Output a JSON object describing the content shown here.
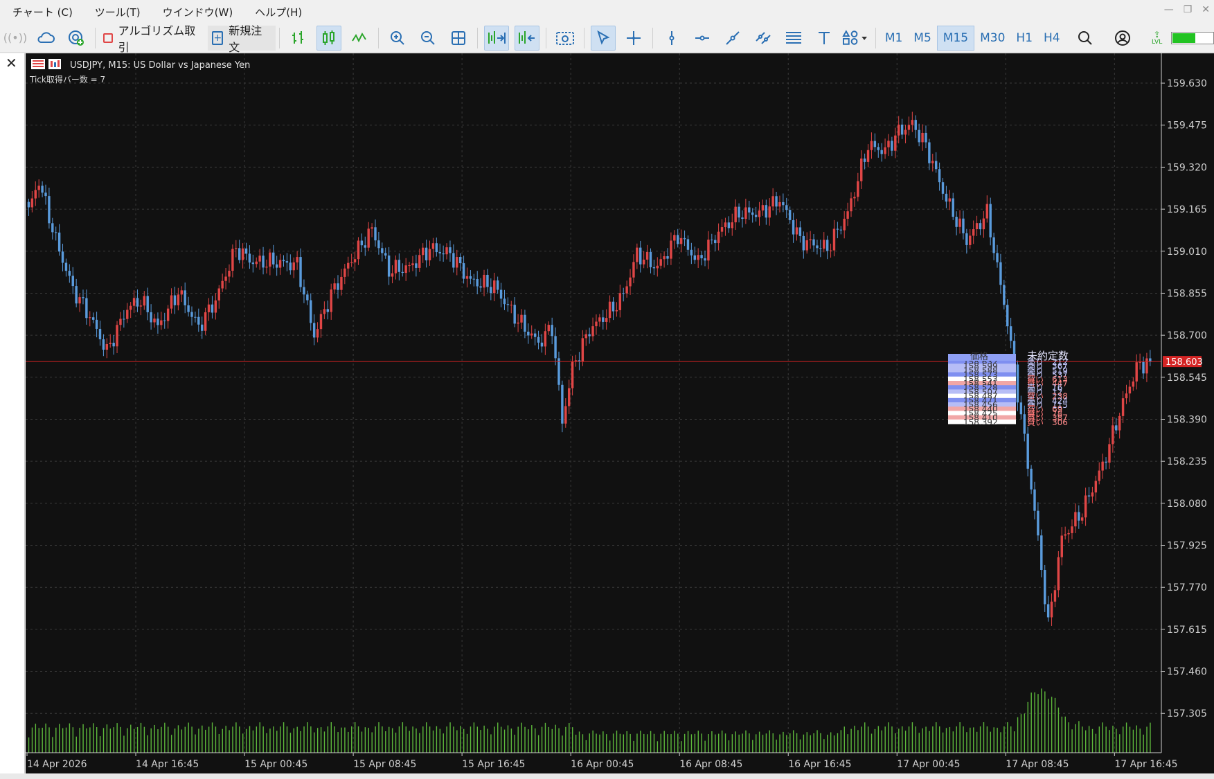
{
  "menu": [
    "チャート (C)",
    "ツール(T)",
    "ウインドウ(W)",
    "ヘルプ(H)"
  ],
  "window_controls": [
    "—",
    "❐",
    "✕"
  ],
  "toolbar": {
    "algo_label": "アルゴリズム取引",
    "new_order_label": "新規注文",
    "timeframes": [
      "M1",
      "M5",
      "M15",
      "M30",
      "H1",
      "H4"
    ],
    "active_timeframe": "M15",
    "level_label": "LVL",
    "level_fill_fraction": 0.55
  },
  "chart": {
    "title": "USDJPY, M15:  US Dollar vs Japanese Yen",
    "indicator_text": "Tick取得バー数 = 7",
    "current_price_label": "158.603",
    "order_book_headers": [
      "価格",
      "未約定数"
    ]
  },
  "colors": {
    "background": "#111111",
    "grid": "#3a3a3a",
    "bull": "#e04646",
    "bear": "#5a9bdc",
    "volume": "#5db83b",
    "price_line": "#d42424",
    "axis_text": "#cfcfcf"
  },
  "chart_data": {
    "type": "candlestick",
    "symbol": "USDJPY",
    "timeframe": "M15",
    "y_ticks": [
      159.63,
      159.475,
      159.32,
      159.165,
      159.01,
      158.855,
      158.7,
      158.545,
      158.39,
      158.235,
      158.08,
      157.925,
      157.77,
      157.615,
      157.46,
      157.305
    ],
    "y_tick_labels": [
      "159.630",
      "159.475",
      "159.320",
      "159.165",
      "159.010",
      "158.855",
      "158.700",
      "158.545",
      "158.390",
      "158.235",
      "158.080",
      "157.925",
      "157.770",
      "157.615",
      "157.460",
      "157.305"
    ],
    "ylim": [
      157.16,
      159.74
    ],
    "x_ticks": [
      "14 Apr 2026",
      "14 Apr 16:45",
      "15 Apr 00:45",
      "15 Apr 08:45",
      "15 Apr 16:45",
      "16 Apr 00:45",
      "16 Apr 08:45",
      "16 Apr 16:45",
      "17 Apr 00:45",
      "17 Apr 08:45",
      "17 Apr 16:45"
    ],
    "bars_per_tick": 32,
    "current_price": 158.603,
    "close_path": [
      [
        0,
        159.16
      ],
      [
        3,
        159.27
      ],
      [
        8,
        159.05
      ],
      [
        13,
        158.87
      ],
      [
        18,
        158.77
      ],
      [
        23,
        158.64
      ],
      [
        29,
        158.8
      ],
      [
        33,
        158.83
      ],
      [
        38,
        158.73
      ],
      [
        44,
        158.86
      ],
      [
        50,
        158.73
      ],
      [
        55,
        158.83
      ],
      [
        61,
        159.02
      ],
      [
        66,
        158.97
      ],
      [
        72,
        158.97
      ],
      [
        79,
        158.96
      ],
      [
        84,
        158.7
      ],
      [
        89,
        158.85
      ],
      [
        95,
        158.98
      ],
      [
        101,
        159.09
      ],
      [
        106,
        158.94
      ],
      [
        112,
        158.95
      ],
      [
        118,
        159.02
      ],
      [
        124,
        159.0
      ],
      [
        130,
        158.9
      ],
      [
        137,
        158.88
      ],
      [
        143,
        158.77
      ],
      [
        150,
        158.67
      ],
      [
        154,
        158.73
      ],
      [
        157,
        158.38
      ],
      [
        160,
        158.58
      ],
      [
        165,
        158.72
      ],
      [
        172,
        158.8
      ],
      [
        175,
        158.85
      ],
      [
        179,
        159.0
      ],
      [
        185,
        158.95
      ],
      [
        191,
        159.07
      ],
      [
        197,
        158.97
      ],
      [
        203,
        159.08
      ],
      [
        209,
        159.15
      ],
      [
        215,
        159.15
      ],
      [
        221,
        159.2
      ],
      [
        227,
        159.05
      ],
      [
        235,
        159.02
      ],
      [
        241,
        159.15
      ],
      [
        247,
        159.4
      ],
      [
        252,
        159.38
      ],
      [
        256,
        159.45
      ],
      [
        260,
        159.48
      ],
      [
        264,
        159.4
      ],
      [
        270,
        159.2
      ],
      [
        276,
        159.05
      ],
      [
        282,
        159.15
      ],
      [
        288,
        158.75
      ],
      [
        292,
        158.4
      ],
      [
        296,
        158.05
      ],
      [
        300,
        157.63
      ],
      [
        304,
        157.95
      ],
      [
        310,
        158.05
      ],
      [
        316,
        158.22
      ],
      [
        322,
        158.45
      ],
      [
        326,
        158.58
      ],
      [
        330,
        158.61
      ]
    ],
    "xlabel": "",
    "ylabel": ""
  },
  "order_book": {
    "rows": [
      {
        "price": "158.632",
        "label": "売り",
        "qty": "212",
        "side": "sell"
      },
      {
        "price": "158.599",
        "label": "売り",
        "qty": "367",
        "side": "sell"
      },
      {
        "price": "158.588",
        "label": "売り",
        "qty": "519",
        "side": "sell"
      },
      {
        "price": "158.573",
        "label": "売り",
        "qty": "537",
        "side": "sell"
      },
      {
        "price": "158.553",
        "label": "買い",
        "qty": "613",
        "side": "buy"
      },
      {
        "price": "158.541",
        "label": "買い",
        "qty": "447",
        "side": "buy"
      },
      {
        "price": "158.528",
        "label": "売り",
        "qty": "16",
        "side": "sell"
      },
      {
        "price": "158.507",
        "label": "売り",
        "qty": "12",
        "side": "sell"
      },
      {
        "price": "158.487",
        "label": "買い",
        "qty": "238",
        "side": "buy"
      },
      {
        "price": "158.471",
        "label": "売り",
        "qty": "424",
        "side": "sell"
      },
      {
        "price": "158.456",
        "label": "売り",
        "qty": "115",
        "side": "sell"
      },
      {
        "price": "158.440",
        "label": "買い",
        "qty": "69",
        "side": "buy"
      },
      {
        "price": "158.425",
        "label": "買い",
        "qty": "78",
        "side": "buy"
      },
      {
        "price": "158.410",
        "label": "買い",
        "qty": "387",
        "side": "buy"
      },
      {
        "price": "158.392",
        "label": "買い",
        "qty": "306",
        "side": "buy"
      }
    ]
  }
}
